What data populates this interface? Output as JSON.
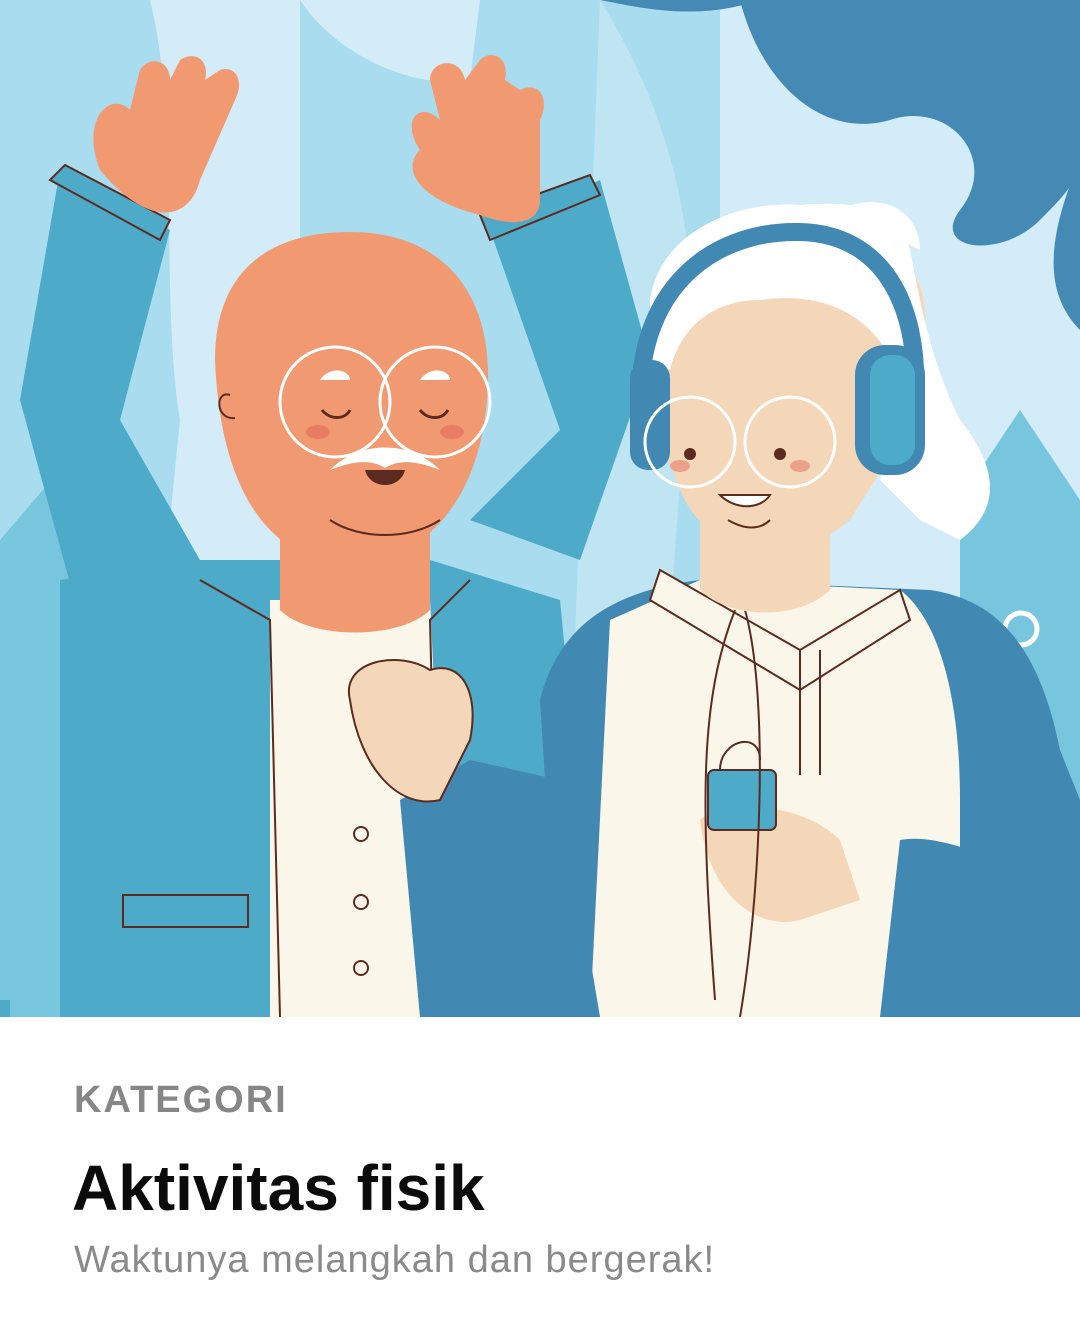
{
  "card": {
    "eyebrow": "KATEGORI",
    "title": "Aktivitas fisik",
    "subtitle": "Waktunya melangkah dan bergerak!"
  },
  "colors": {
    "background_light": "#d4ecf7",
    "background_mid": "#a9dcee",
    "background_leaf": "#4589b5",
    "jacket": "#4eaac9",
    "jacket_dark": "#4189b3",
    "skin_man": "#f19a72",
    "skin_woman": "#f4d7b9",
    "shirt": "#fbf6ea",
    "text_primary": "#0b0b0b",
    "text_secondary": "#868686"
  },
  "illustration": {
    "subject": "elderly-couple-dancing-with-headphones",
    "icons": [
      "headphones-icon",
      "music-player-icon",
      "glasses-icon"
    ]
  }
}
